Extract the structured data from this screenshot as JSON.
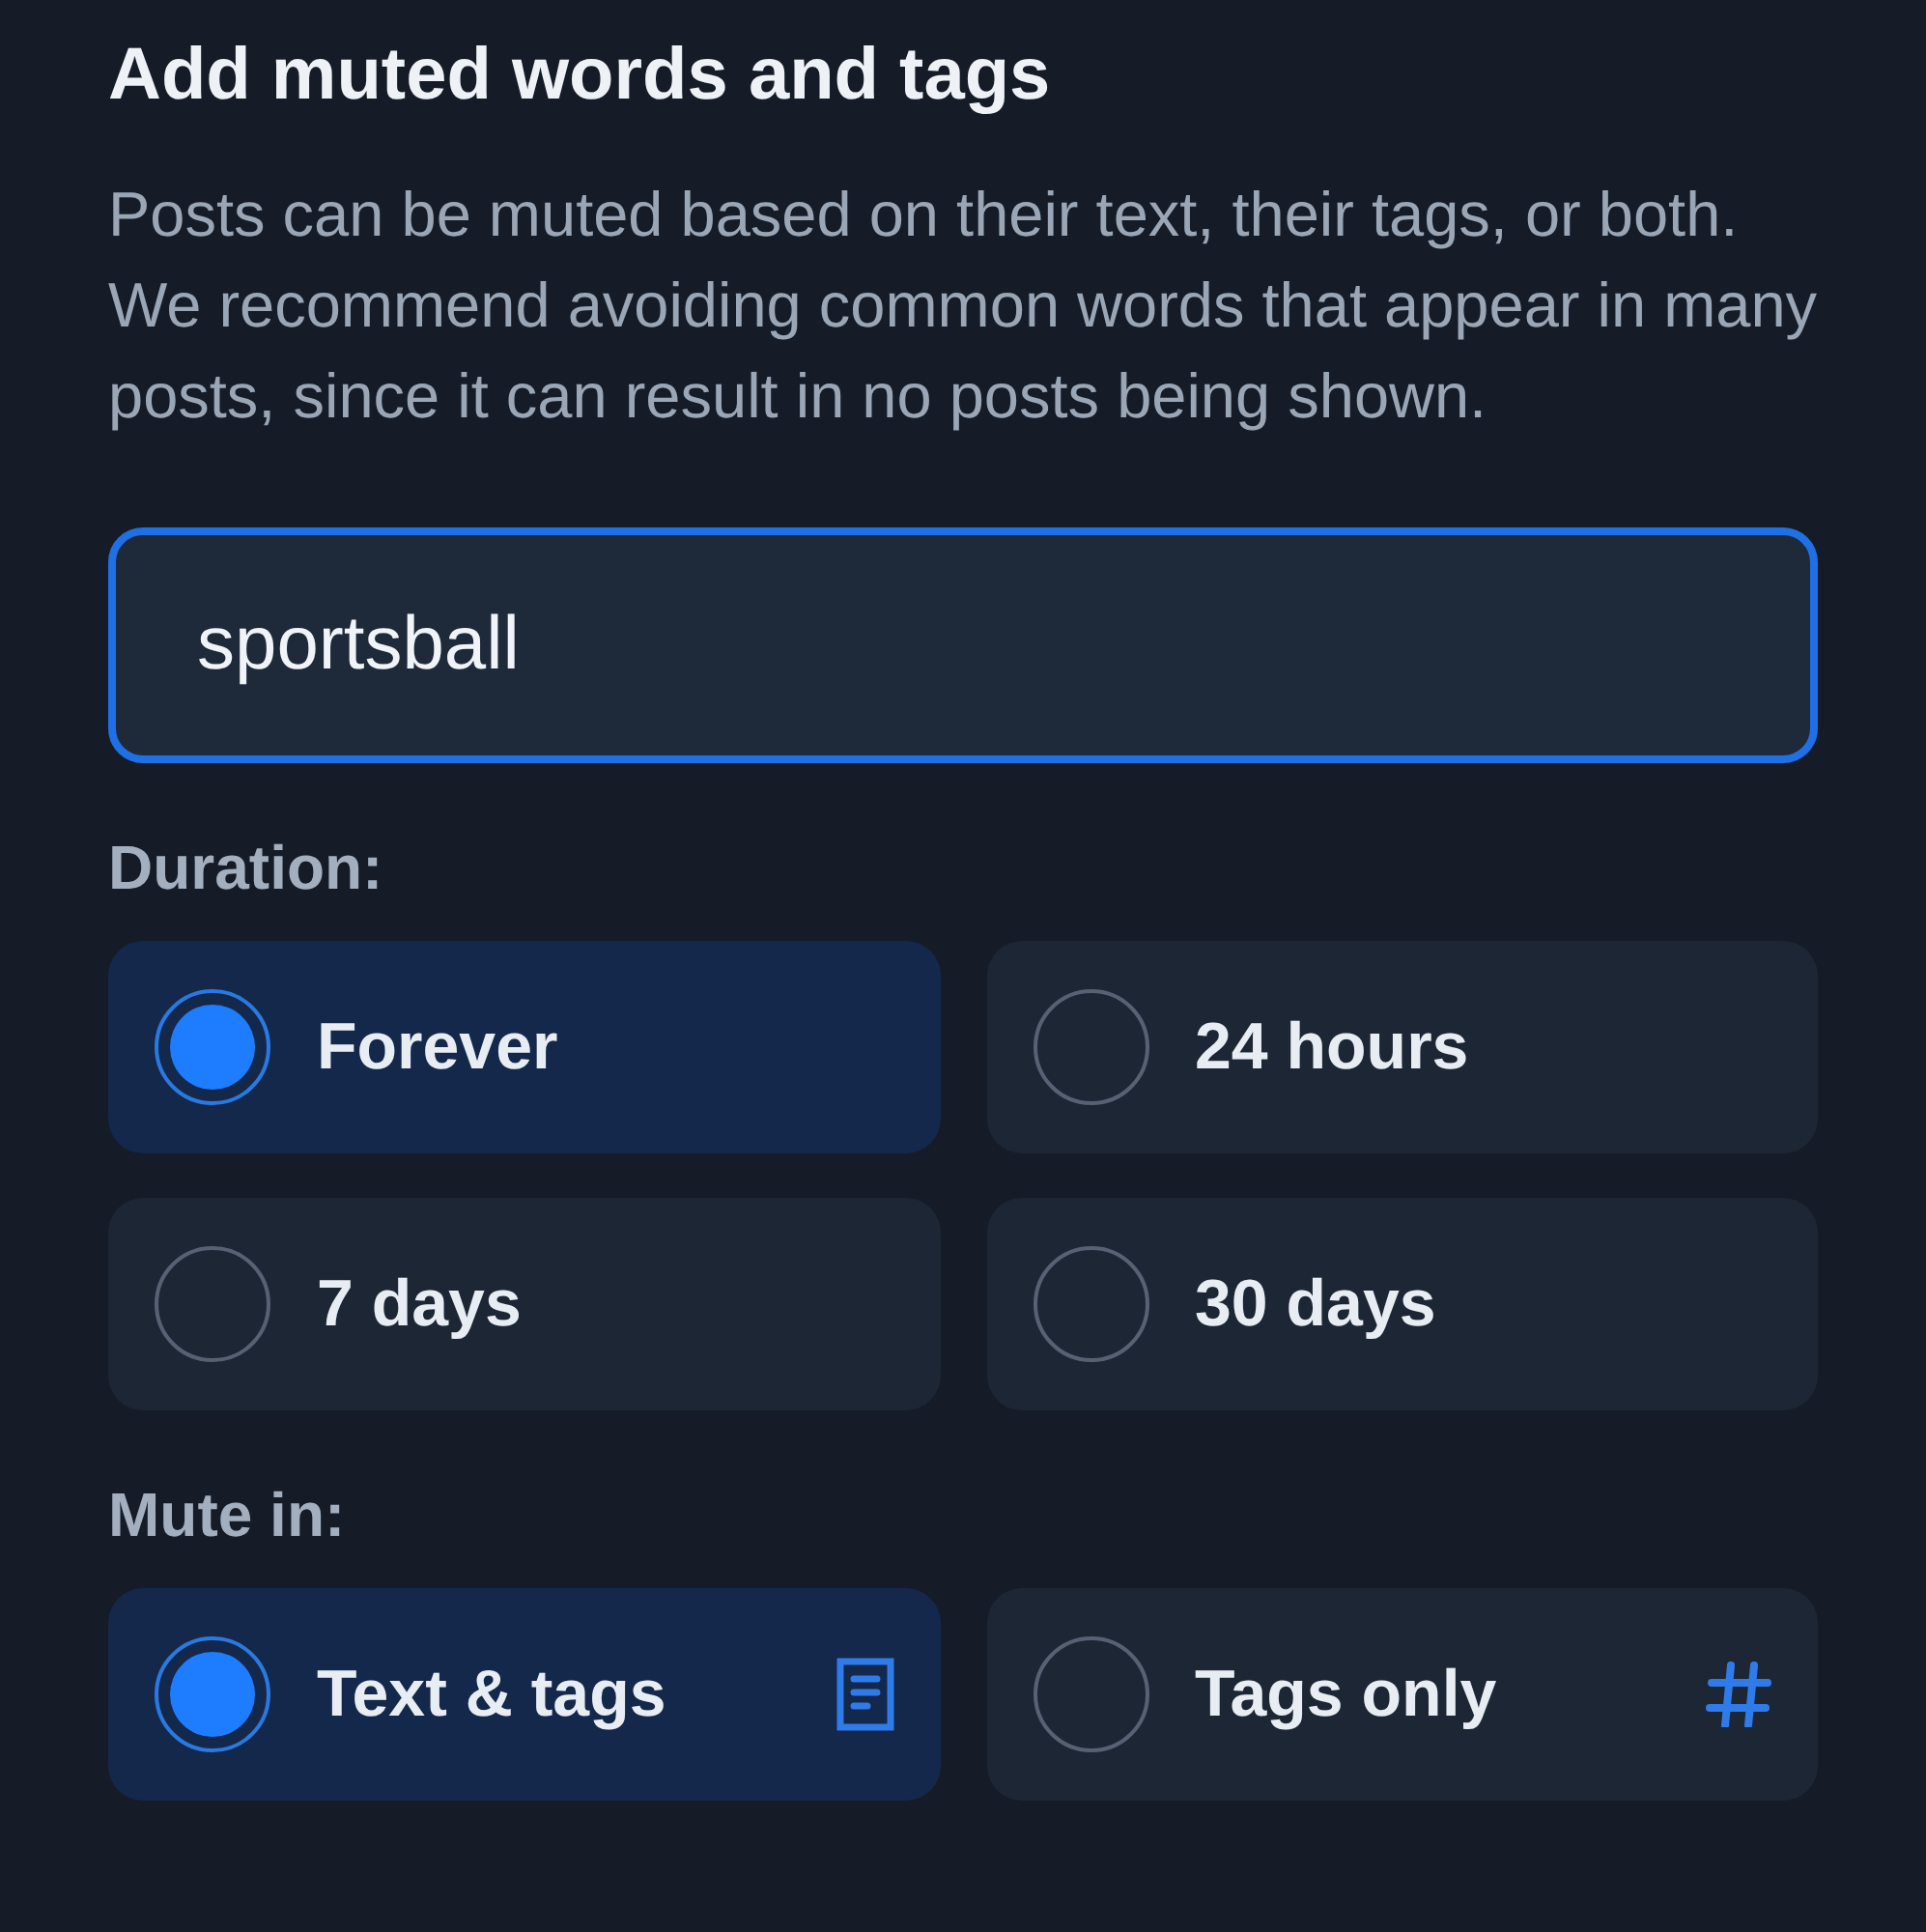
{
  "title": "Add muted words and tags",
  "description": "Posts can be muted based on their text, their tags, or both. We recommend avoiding common words that appear in many posts, since it can result in no posts being shown.",
  "input": {
    "value": "sportsball",
    "focused": true
  },
  "duration": {
    "label": "Duration:",
    "options": [
      {
        "label": "Forever",
        "selected": true
      },
      {
        "label": "24 hours",
        "selected": false
      },
      {
        "label": "7 days",
        "selected": false
      },
      {
        "label": "30 days",
        "selected": false
      }
    ]
  },
  "mute_in": {
    "label": "Mute in:",
    "options": [
      {
        "label": "Text & tags",
        "selected": true
      },
      {
        "label": "Tags only",
        "selected": false
      }
    ]
  }
}
